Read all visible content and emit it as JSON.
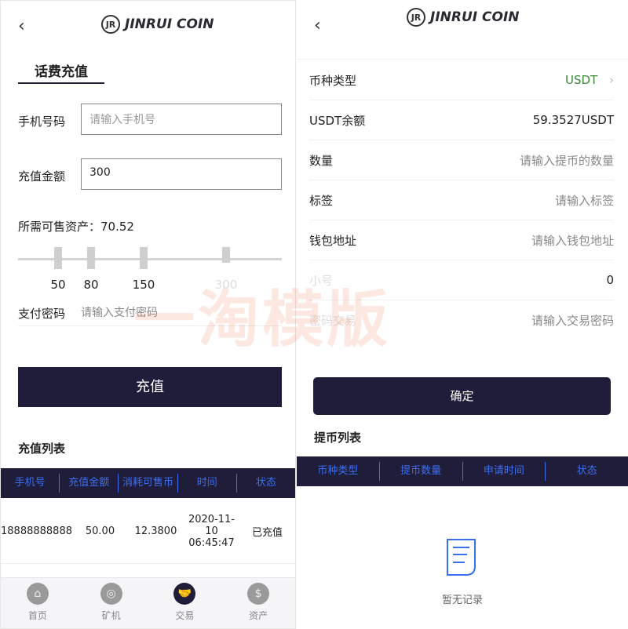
{
  "left": {
    "logo": "JINRUI COIN",
    "logo_mark": "JR",
    "tab": "话费充值",
    "phone_label": "手机号码",
    "phone_placeholder": "请输入手机号",
    "amount_label": "充值金额",
    "amount_value": "300",
    "required": "所需可售资产：70.52",
    "slider_ticks": [
      "50",
      "80",
      "150",
      "300"
    ],
    "pay_label": "支付密码",
    "pay_placeholder": "请输入支付密码",
    "submit": "充值",
    "list_title": "充值列表",
    "columns": [
      "手机号",
      "充值金额",
      "消耗可售币",
      "时间",
      "状态"
    ],
    "rows": [
      {
        "phone": "18888888888",
        "amount": "50.00",
        "cost": "12.3800",
        "date": "2020-11-10",
        "time": "06:45:47",
        "status": "已充值"
      }
    ],
    "nav": [
      {
        "label": "首页",
        "icon": "home-icon"
      },
      {
        "label": "矿机",
        "icon": "miner-icon"
      },
      {
        "label": "交易",
        "icon": "handshake-icon",
        "active": true
      },
      {
        "label": "资产",
        "icon": "dollar-icon"
      }
    ]
  },
  "right": {
    "logo": "JINRUI COIN",
    "logo_mark": "JR",
    "fields": [
      {
        "label": "币种类型",
        "value": "USDT"
      },
      {
        "label": "USDT余额",
        "value": "59.3527USDT"
      },
      {
        "label": "数量",
        "placeholder": "请输入提币的数量"
      },
      {
        "label": "标签",
        "placeholder": "请输入标签"
      },
      {
        "label": "钱包地址",
        "placeholder": "请输入钱包地址"
      },
      {
        "label": "小号",
        "value": "0"
      },
      {
        "label": "密码交易",
        "placeholder": "请输入交易密码"
      }
    ],
    "submit": "确定",
    "list_title": "提币列表",
    "columns": [
      "币种类型",
      "提币数量",
      "申请时间",
      "状态"
    ],
    "empty": "暂无记录"
  },
  "watermark": "一淘模版",
  "colors": {
    "primary": "#201d3a",
    "header_text": "#3b6ef0",
    "usdt": "#3a8a3a"
  }
}
